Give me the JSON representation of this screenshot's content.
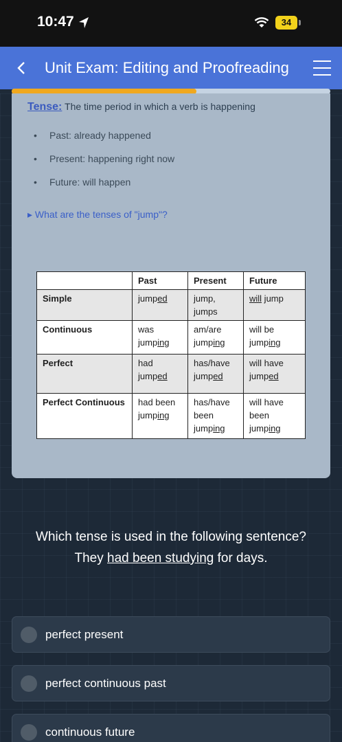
{
  "status_bar": {
    "time": "10:47",
    "battery": "34"
  },
  "header": {
    "title": "Unit Exam: Editing and Proofreading"
  },
  "progress": {
    "fraction": 0.58,
    "color": "#f0a81e"
  },
  "lesson": {
    "term": "Tense:",
    "definition": " The time period in which a verb is happening",
    "bullets": [
      "Past: already happened",
      "Present: happening right now",
      "Future: will happen"
    ],
    "summary_toggle": "What are the tenses of \"jump\"?"
  },
  "table": {
    "headers": [
      "",
      "Past",
      "Present",
      "Future"
    ],
    "rows": [
      {
        "label": "Simple",
        "past": [
          "jump",
          "ed"
        ],
        "present": "jump, jumps",
        "future": [
          "will",
          " jump"
        ]
      },
      {
        "label": "Continuous",
        "past": [
          "was jump",
          "ing"
        ],
        "present": [
          "am/are jump",
          "ing"
        ],
        "future": [
          "will be jump",
          "ing"
        ]
      },
      {
        "label": "Perfect",
        "past": [
          "had jump",
          "ed"
        ],
        "present": [
          "has/have jump",
          "ed"
        ],
        "future": [
          "will have jump",
          "ed"
        ]
      },
      {
        "label": "Perfect Continuous",
        "past": [
          "had been jump",
          "ing"
        ],
        "present": [
          "has/have been jump",
          "ing"
        ],
        "future": [
          "will have been jump",
          "ing"
        ]
      }
    ]
  },
  "question": {
    "line1": "Which tense is used in the following sentence?",
    "pre": "They ",
    "underlined": "had been studying",
    "post": " for days."
  },
  "options": [
    "perfect present",
    "perfect continuous past",
    "continuous future"
  ],
  "colors": {
    "header": "#4a73d8",
    "background": "#1d2937",
    "card": "#a9b8c8",
    "link": "#3a5fc8"
  }
}
